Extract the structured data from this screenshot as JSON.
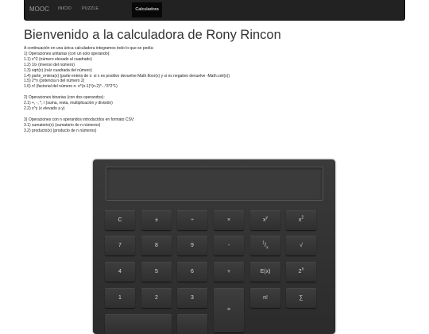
{
  "navbar": {
    "brand": "MOOC",
    "links": [
      "INICIO",
      "PUZZLE"
    ],
    "active": "Calculadora"
  },
  "title": "Bienvenido a la calculadora de Rony Rincon",
  "description": [
    "A continuación en una única calculadora integramos todo lo que se pedía:",
    "1) Operaciones unitarias (con un solo operando):",
    "1.1) x^2 (número elevado al cuadrado)",
    "1.2) 1/x (inverso del número)",
    "1.3) sqrt(x) (raíz cuadrada del número)",
    "1.4) parte_entera(x) (parte entera de x: si x es positivo devuelve Math.floor(x) y si es negativo devuelve -Math.ceil(x))",
    "1.5) 2^n (potencia n del número 2)",
    "1.6) n! (factorial del número n: n*(n-1)*(n-2)*...*3*2*1)",
    "",
    "2) Operaciones binarias (con dos operandos):",
    "2.1) +, -, *, / (suma, resta, multiplicación y división)",
    "2.2) x^y (x elevado a y)",
    "",
    "3) Operaciones con n operandos introducidos en formato CSV:",
    "3.1) sumatorio(x) (sumatorio de n números)",
    "3.2) producto(x) (producto de n números)"
  ],
  "calculator": {
    "display": "",
    "keys": {
      "clear": "C",
      "plus_minus": "±",
      "divide": "÷",
      "multiply": "×",
      "power_base": "x",
      "power_exp": "y",
      "square_base": "x",
      "square_exp": "2",
      "seven": "7",
      "eight": "8",
      "nine": "9",
      "minus": "-",
      "inverse_num": "1",
      "inverse_den": "x",
      "sqrt": "√",
      "four": "4",
      "five": "5",
      "six": "6",
      "plus": "+",
      "floor": "E(x)",
      "two_n_base": "2",
      "two_n_exp": "n",
      "one": "1",
      "two": "2",
      "three": "3",
      "equals": "=",
      "factorial": "n!",
      "sum": "∑"
    }
  }
}
